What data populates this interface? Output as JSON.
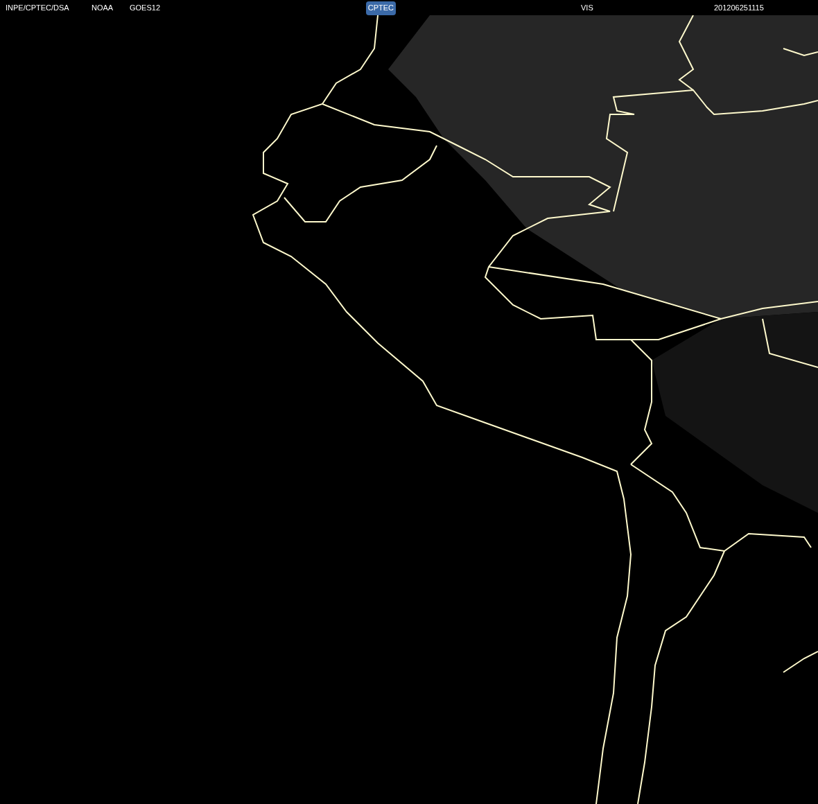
{
  "header": {
    "labels": [
      "INPE/CPTEC/DSA",
      "NOAA",
      "GOES12"
    ],
    "logo_text": "CPTEC",
    "channel": "VIS",
    "timestamp": "201206251115"
  }
}
